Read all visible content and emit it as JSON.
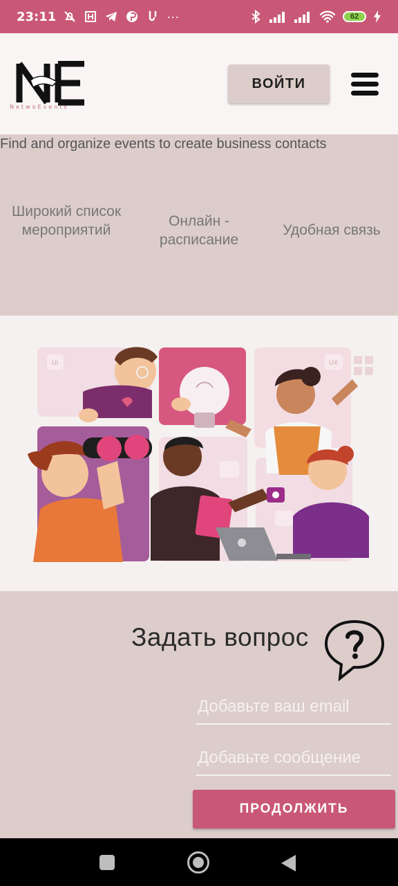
{
  "status_bar": {
    "time": "23:11",
    "more": "···",
    "battery": "62",
    "left_icons": [
      "muted-bell-icon",
      "app-icon",
      "telegram-icon",
      "pinterest-icon",
      "notification-icon"
    ],
    "right_icons": [
      "bluetooth-icon",
      "signal-icon",
      "signal-icon",
      "wifi-icon",
      "battery-icon",
      "charging-icon"
    ]
  },
  "header": {
    "logo_letters": "NE",
    "logo_tagline": "NetwoEvents",
    "login_label": "ВОЙТИ",
    "menu_icon": "hamburger-menu-icon"
  },
  "hero": {
    "tagline": "Find and organize events to create business contacts"
  },
  "features": [
    {
      "label": "Широкий список мероприятий"
    },
    {
      "label": "Онлайн - расписание"
    },
    {
      "label": "Удобная связь"
    }
  ],
  "illustration": {
    "icon": "team-collaboration-illustration",
    "tile_labels": [
      "UI",
      "UX"
    ]
  },
  "question": {
    "title": "Задать вопрос",
    "icon": "question-speech-bubble-icon",
    "email_placeholder": "Добавьте ваш email",
    "message_placeholder": "Добавьте сообщение",
    "submit_label": "ПРОДОЛЖИТЬ"
  },
  "nav_bar": {
    "icons": [
      "recents-square-icon",
      "home-circle-icon",
      "back-triangle-icon"
    ]
  },
  "colors": {
    "accent": "#c95876",
    "band": "#dccdcb",
    "header_bg": "#f8f5f4"
  }
}
